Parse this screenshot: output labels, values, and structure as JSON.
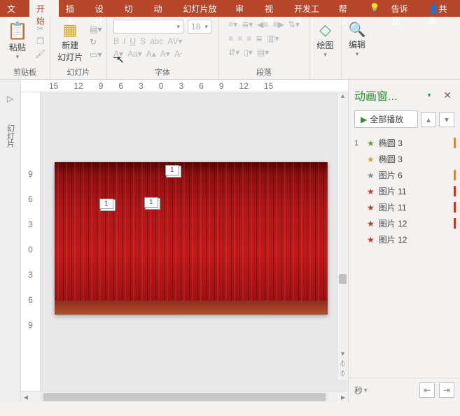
{
  "tabs": {
    "file": "文件",
    "home": "开始",
    "insert": "插入",
    "design": "设计",
    "transition": "切换",
    "animation": "动画",
    "slideshow": "幻灯片放映",
    "review": "审阅",
    "view": "视图",
    "devtools": "开发工具",
    "help": "帮助",
    "tellme": "告诉我",
    "share": "共享"
  },
  "ribbon": {
    "clipboard": {
      "paste": "粘贴",
      "label": "剪贴板"
    },
    "slides": {
      "newslide": "新建\n幻灯片",
      "label": "幻灯片"
    },
    "font": {
      "label": "字体",
      "size": "18"
    },
    "paragraph": {
      "label": "段落"
    },
    "drawing": {
      "btn": "绘图"
    },
    "editing": {
      "btn": "编辑"
    }
  },
  "ruler_h": [
    "15",
    "12",
    "9",
    "6",
    "3",
    "0",
    "3",
    "6",
    "9",
    "12",
    "15"
  ],
  "ruler_v": [
    "9",
    "6",
    "3",
    "0",
    "3",
    "6",
    "9"
  ],
  "slide_tags": {
    "t1": "1",
    "t2": "1",
    "t3": "1"
  },
  "pane": {
    "title": "动画窗...",
    "play_all": "全部播放",
    "seconds": "秒",
    "items": [
      {
        "num": "1",
        "star": "green",
        "label": "椭圆 3",
        "bar": "o"
      },
      {
        "num": "",
        "star": "yellow",
        "label": "椭圆 3",
        "bar": ""
      },
      {
        "num": "",
        "star": "gray",
        "label": "图片 6",
        "bar": "o"
      },
      {
        "num": "",
        "star": "red",
        "label": "图片 11",
        "bar": "r"
      },
      {
        "num": "",
        "star": "red",
        "label": "图片 11",
        "bar": "r"
      },
      {
        "num": "",
        "star": "red",
        "label": "图片 12",
        "bar": "r"
      },
      {
        "num": "",
        "star": "red",
        "label": "图片 12",
        "bar": ""
      }
    ]
  },
  "sidebar": {
    "outline": "幻灯片"
  }
}
